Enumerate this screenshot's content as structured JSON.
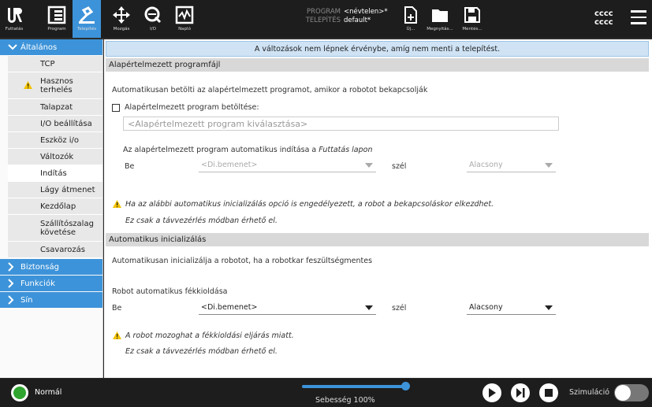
{
  "topbar": {
    "tabs": [
      {
        "label": "Futtatás",
        "icon": "ur-logo-icon"
      },
      {
        "label": "Program",
        "icon": "program-icon"
      },
      {
        "label": "Telepítés",
        "icon": "installation-icon",
        "active": true
      },
      {
        "label": "Mozgás",
        "icon": "move-icon"
      },
      {
        "label": "I/O",
        "icon": "io-icon"
      },
      {
        "label": "Napló",
        "icon": "log-icon"
      }
    ],
    "program_key": "PROGRAM",
    "program_value": "<névtelen>*",
    "install_key": "TELEPÍTÉS",
    "install_value": "default*",
    "file_buttons": [
      {
        "label": "Új...",
        "icon": "new-file-icon"
      },
      {
        "label": "Megnyitás...",
        "icon": "open-folder-icon"
      },
      {
        "label": "Mentés...",
        "icon": "save-icon"
      }
    ],
    "user_line1": "cccc",
    "user_line2": "cccc"
  },
  "leftnav": {
    "general": "Általános",
    "items": [
      {
        "label": "TCP"
      },
      {
        "label": "Hasznos terhelés",
        "warning": true
      },
      {
        "label": "Talapzat"
      },
      {
        "label": "I/O beállítása"
      },
      {
        "label": "Eszköz i/o"
      },
      {
        "label": "Változók"
      },
      {
        "label": "Indítás",
        "selected": true
      },
      {
        "label": "Lágy átmenet"
      },
      {
        "label": "Kezdőlap"
      },
      {
        "label": "Szállítószalag követése"
      },
      {
        "label": "Csavarozás"
      }
    ],
    "groups": [
      "Biztonság",
      "Funkciók",
      "Sín"
    ]
  },
  "main": {
    "notice": "A változások nem lépnek érvénybe, amíg nem menti a telepítést.",
    "section1": {
      "title": "Alapértelmezett programfájl",
      "desc": "Automatikusan betölti az alapértelmezett programot, amikor a robotot bekapcsolják",
      "checkbox_label": "Alapértelmezett program betöltése:",
      "program_placeholder": "<Alapértelmezett program kiválasztása>",
      "autostart_prefix": "Az alapértelmezett program automatikus indítása a ",
      "autostart_italic": "Futtatás lapon",
      "be_label": "Be",
      "input_value": "<Di.bemenet>",
      "edge_label": "szél",
      "level_value": "Alacsony",
      "warning1": "Ha az alábbi automatikus inicializálás opció is engedélyezett, a robot a bekapcsoláskor elkezdhet.",
      "warning1b": "Ez csak a távvezérlés módban érhető el."
    },
    "section2": {
      "title": "Automatikus inicializálás",
      "desc": "Automatikusan inicializálja a robotot, ha a robotkar feszültségmentes",
      "brake_label": "Robot automatikus fékkioldása",
      "be_label": "Be",
      "input_value": "<Di.bemenet>",
      "edge_label": "szél",
      "level_value": "Alacsony",
      "warning2": "A robot mozoghat a fékkioldási eljárás miatt.",
      "warning2b": "Ez csak a távvezérlés módban érhető el."
    }
  },
  "bottombar": {
    "status": "Normál",
    "status_color": "#2fa52f",
    "speed_text": "Sebesség 100%",
    "speed_fraction": 1.0,
    "simulation_label": "Szimuláció",
    "simulation_on": false
  },
  "colors": {
    "accent": "#3d93d9",
    "warning": "#f2c200"
  }
}
